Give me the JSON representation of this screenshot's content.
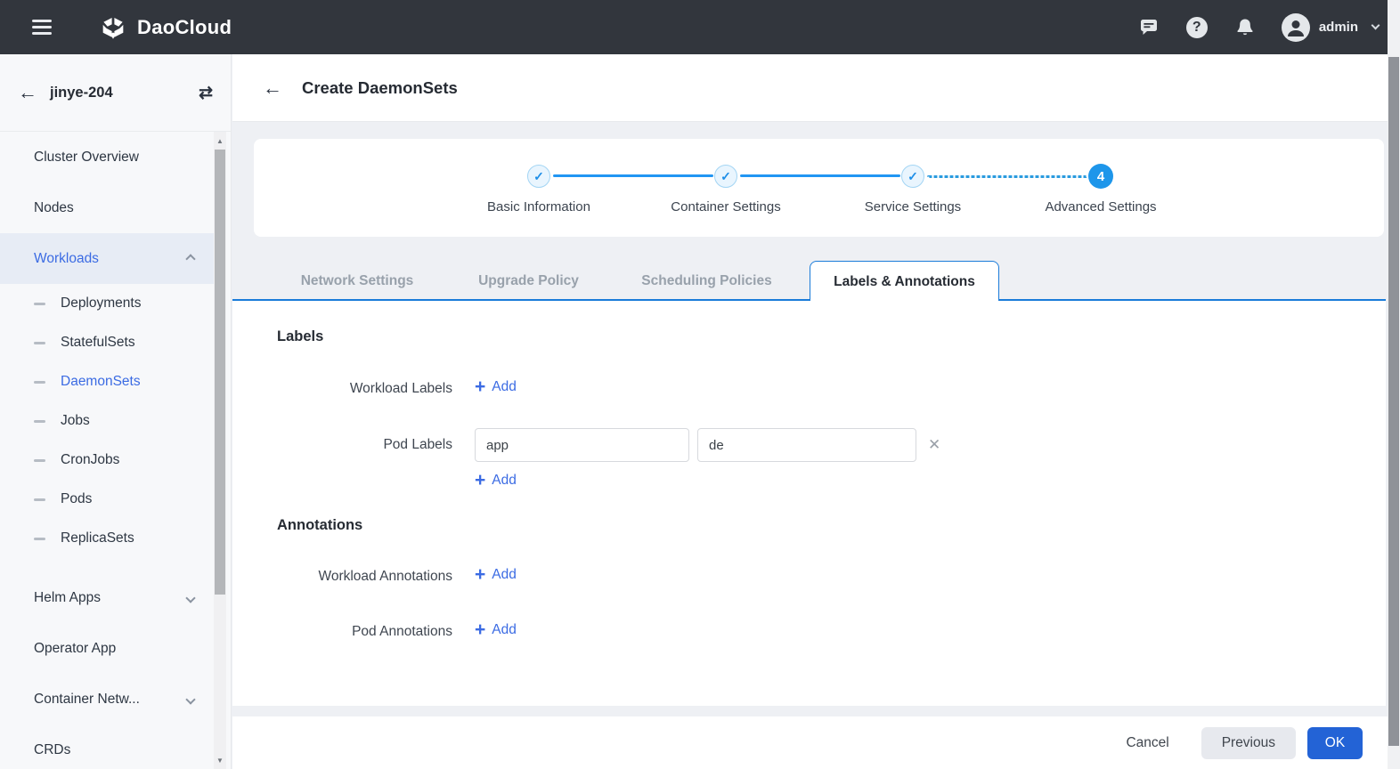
{
  "colors": {
    "topbar_bg": "#32363d",
    "accent_blue": "#3b6be3",
    "stepper_blue": "#2196f3",
    "tab_blue": "#1a7bd9",
    "ok_blue": "#2363d6",
    "page_bg": "#eef0f4"
  },
  "topbar": {
    "brand": "DaoCloud",
    "user": "admin"
  },
  "sidebar": {
    "cluster": "jinye-204",
    "items": [
      {
        "label": "Cluster Overview"
      },
      {
        "label": "Nodes"
      },
      {
        "label": "Workloads"
      },
      {
        "label": "Deployments"
      },
      {
        "label": "StatefulSets"
      },
      {
        "label": "DaemonSets"
      },
      {
        "label": "Jobs"
      },
      {
        "label": "CronJobs"
      },
      {
        "label": "Pods"
      },
      {
        "label": "ReplicaSets"
      },
      {
        "label": "Helm Apps"
      },
      {
        "label": "Operator App"
      },
      {
        "label": "Container Netw..."
      },
      {
        "label": "CRDs"
      }
    ]
  },
  "page": {
    "title": "Create DaemonSets"
  },
  "stepper": {
    "steps": [
      {
        "label": "Basic Information",
        "state": "done"
      },
      {
        "label": "Container Settings",
        "state": "done"
      },
      {
        "label": "Service Settings",
        "state": "done"
      },
      {
        "label": "Advanced Settings",
        "state": "current",
        "number": "4"
      }
    ]
  },
  "tabs": [
    {
      "label": "Network Settings"
    },
    {
      "label": "Upgrade Policy"
    },
    {
      "label": "Scheduling Policies"
    },
    {
      "label": "Labels & Annotations"
    }
  ],
  "form": {
    "add_label": "Add",
    "labels": {
      "heading": "Labels",
      "workload_label": "Workload Labels",
      "pod_label": "Pod Labels",
      "key": "app",
      "value": "de"
    },
    "annotations": {
      "heading": "Annotations",
      "workload_label": "Workload Annotations",
      "pod_label": "Pod Annotations"
    }
  },
  "footer": {
    "cancel": "Cancel",
    "previous": "Previous",
    "ok": "OK"
  }
}
